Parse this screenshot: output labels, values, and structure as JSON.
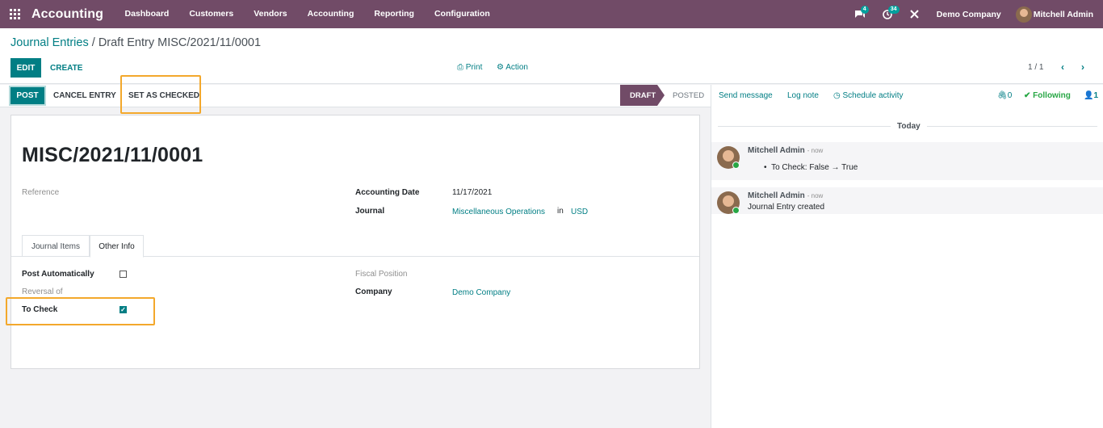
{
  "navbar": {
    "app_name": "Accounting",
    "menu": [
      "Dashboard",
      "Customers",
      "Vendors",
      "Accounting",
      "Reporting",
      "Configuration"
    ],
    "messages_count": "4",
    "activities_count": "34",
    "company": "Demo Company",
    "user": "Mitchell Admin"
  },
  "breadcrumb": {
    "parent": "Journal Entries",
    "separator": "/",
    "current": "Draft Entry MISC/2021/11/0001"
  },
  "toolbar": {
    "edit": "EDIT",
    "create": "CREATE",
    "print": "Print",
    "action": "Action",
    "pager": "1 / 1"
  },
  "statusbar": {
    "post": "POST",
    "cancel_entry": "CANCEL ENTRY",
    "set_as_checked": "SET AS CHECKED",
    "stage_draft": "DRAFT",
    "stage_posted": "POSTED"
  },
  "form": {
    "entry_name": "MISC/2021/11/0001",
    "reference_label": "Reference",
    "accounting_date_label": "Accounting Date",
    "accounting_date": "11/17/2021",
    "journal_label": "Journal",
    "journal": "Miscellaneous Operations",
    "in": "in",
    "currency": "USD",
    "tabs": [
      "Journal Items",
      "Other Info"
    ],
    "post_automatically_label": "Post Automatically",
    "post_automatically": false,
    "reversal_of_label": "Reversal of",
    "to_check_label": "To Check",
    "to_check": true,
    "fiscal_position_label": "Fiscal Position",
    "company_label": "Company",
    "company": "Demo Company"
  },
  "chatter": {
    "send_message": "Send message",
    "log_note": "Log note",
    "schedule_activity": "Schedule activity",
    "attachments": "0",
    "following": "Following",
    "followers": "1",
    "day_separator": "Today",
    "messages": [
      {
        "author": "Mitchell Admin",
        "time": "- now",
        "body": "To Check: False → True"
      },
      {
        "author": "Mitchell Admin",
        "time": "- now",
        "body": "Journal Entry created"
      }
    ]
  },
  "colors": {
    "brand": "#714b67",
    "accent": "#017e84",
    "highlight": "#f3a82c"
  }
}
